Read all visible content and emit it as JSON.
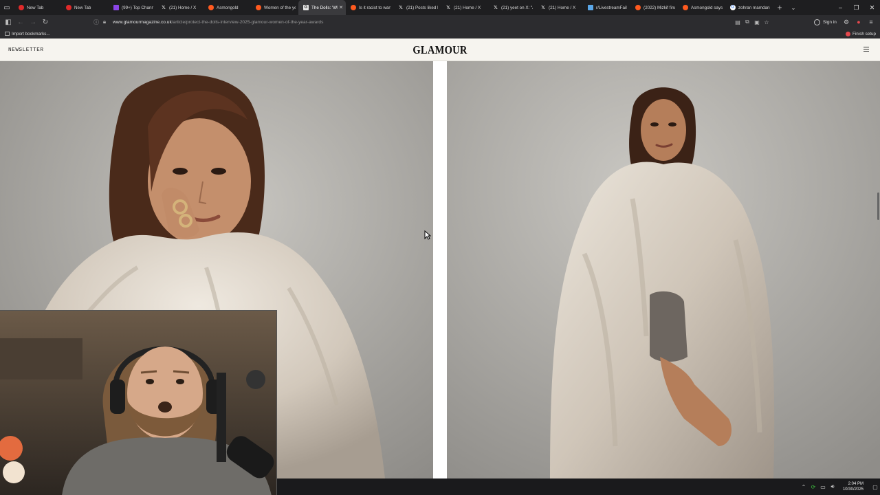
{
  "browser": {
    "tabs": [
      {
        "title": "New Tab",
        "favicon": "youtube-icon",
        "active": false
      },
      {
        "title": "New Tab",
        "favicon": "youtube-icon",
        "active": false
      },
      {
        "title": "(99+) Top Channe",
        "favicon": "twitch-icon",
        "active": false
      },
      {
        "title": "(21) Home / X",
        "favicon": "x-icon",
        "active": false
      },
      {
        "title": "Asmongold",
        "favicon": "reddit-icon",
        "active": false
      },
      {
        "title": "Women of the yea",
        "favicon": "reddit-icon",
        "active": false
      },
      {
        "title": "The Dolls: 'Whe",
        "favicon": "glamour-icon",
        "active": true
      },
      {
        "title": "Is it racist to want",
        "favicon": "reddit-icon",
        "active": false
      },
      {
        "title": "(21) Posts liked by",
        "favicon": "x-icon",
        "active": false
      },
      {
        "title": "(21) Home / X",
        "favicon": "x-icon",
        "active": false
      },
      {
        "title": "(21) yeet on X: \"A",
        "favicon": "x-icon",
        "active": false
      },
      {
        "title": "(21) Home / X",
        "favicon": "x-icon",
        "active": false
      },
      {
        "title": "r/LivestreamFail",
        "favicon": "livestreamfail-icon",
        "active": false
      },
      {
        "title": "(2022) Mizkif finds",
        "favicon": "reddit-icon",
        "active": false
      },
      {
        "title": "Asmongold says /",
        "favicon": "reddit-icon",
        "active": false
      },
      {
        "title": "zohran mamdani",
        "favicon": "google-icon",
        "active": false
      }
    ],
    "url_host": "www.glamourmagazine.co.uk",
    "url_path": "/article/protect-the-dolls-interview-2025-glamour-women-of-the-year-awards",
    "sign_in_label": "Sign in",
    "bookmark_import_label": "Import bookmarks...",
    "finish_setup_label": "Finish setup"
  },
  "site": {
    "newsletter_label": "NEWSLETTER",
    "logo_text": "GLAMOUR"
  },
  "taskbar": {
    "time": "2:04 PM",
    "date": "10/30/2025"
  }
}
